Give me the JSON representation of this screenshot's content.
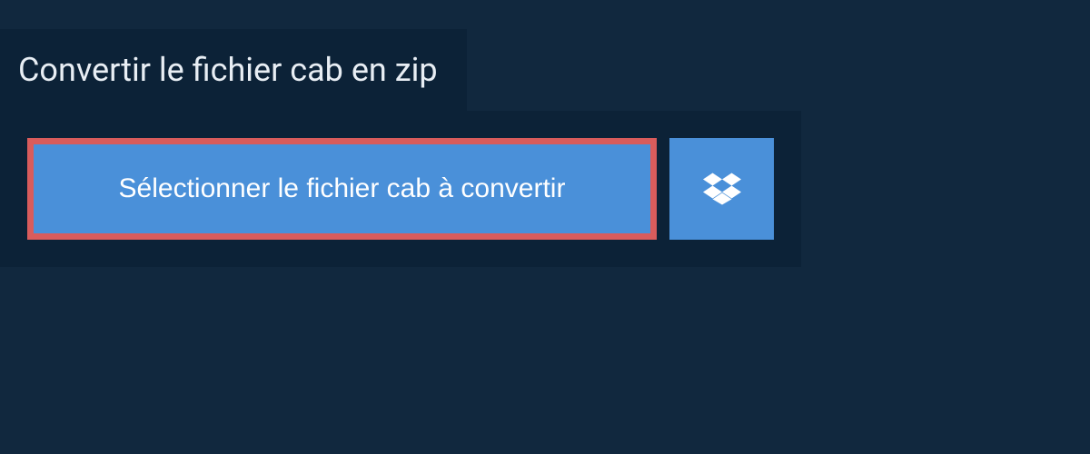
{
  "header": {
    "title": "Convertir le fichier cab en zip"
  },
  "actions": {
    "select_file_label": "Sélectionner le fichier cab à convertir",
    "dropbox_icon": "dropbox"
  },
  "colors": {
    "background": "#11283e",
    "panel": "#0c2237",
    "button": "#4a90d9",
    "highlight_border": "#d95c5c",
    "text": "#ffffff"
  }
}
